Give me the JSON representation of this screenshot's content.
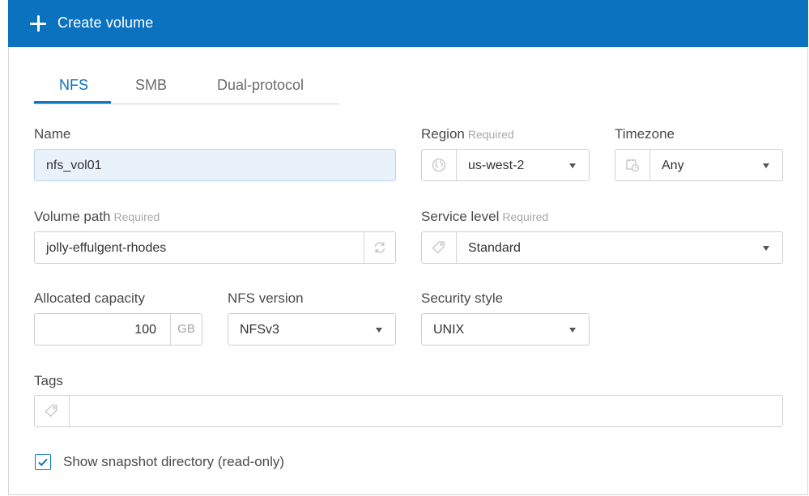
{
  "header": {
    "title": "Create volume"
  },
  "tabs": [
    {
      "label": "NFS",
      "active": true
    },
    {
      "label": "SMB",
      "active": false
    },
    {
      "label": "Dual-protocol",
      "active": false
    }
  ],
  "form": {
    "name": {
      "label": "Name",
      "value": "nfs_vol01"
    },
    "region": {
      "label": "Region",
      "required": "Required",
      "value": "us-west-2",
      "icon": "globe-icon"
    },
    "timezone": {
      "label": "Timezone",
      "value": "Any",
      "icon": "calendar-clock-icon"
    },
    "volume_path": {
      "label": "Volume path",
      "required": "Required",
      "value": "jolly-effulgent-rhodes",
      "icon": "refresh-icon"
    },
    "service_level": {
      "label": "Service level",
      "required": "Required",
      "value": "Standard",
      "icon": "tag-icon"
    },
    "allocated_capacity": {
      "label": "Allocated capacity",
      "value": "100",
      "unit": "GB"
    },
    "nfs_version": {
      "label": "NFS version",
      "value": "NFSv3"
    },
    "security_style": {
      "label": "Security style",
      "value": "UNIX"
    },
    "tags": {
      "label": "Tags",
      "value": "",
      "icon": "tag-icon"
    },
    "snapshot": {
      "label": "Show snapshot directory (read-only)",
      "checked": true
    }
  },
  "colors": {
    "accent": "#0b72bf",
    "field_filled": "#e9f1fb",
    "border": "#cfcfcf"
  }
}
